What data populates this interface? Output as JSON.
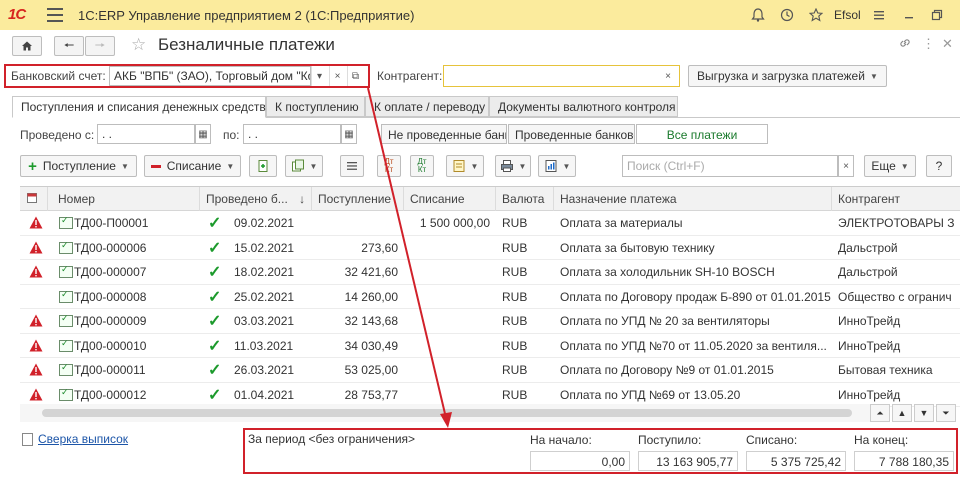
{
  "window": {
    "logo": "1С",
    "title": "1С:ERP Управление предприятием 2  (1С:Предприятие)",
    "user": "Efsol"
  },
  "page": {
    "title": "Безналичные платежи"
  },
  "filters": {
    "bank_label": "Банковский счет:",
    "bank_value": "АКБ \"ВПБ\" (ЗАО), Торговый дом \"Комплексный\"",
    "counterparty_label": "Контрагент:",
    "counterparty_value": "",
    "export_button": "Выгрузка и загрузка платежей",
    "date_from_label": "Проведено с:",
    "date_from_value": " .  .",
    "date_to_label": "по:",
    "date_to_value": " .  .",
    "status_not_posted": "Не проведенные банковские выписки",
    "status_posted": "Проведенные банковские выписки",
    "status_all": "Все платежи"
  },
  "tabs": [
    "Поступления и списания денежных средств",
    "К поступлению",
    "К оплате / переводу",
    "Документы валютного контроля"
  ],
  "toolbar": {
    "receipt": "Поступление",
    "writeoff": "Списание",
    "search_placeholder": "Поиск (Ctrl+F)",
    "more": "Еще",
    "help": "?",
    "dtkt_dt": "Дт",
    "dtkt_kt": "Кт"
  },
  "table": {
    "columns": [
      "Номер",
      "Проведено б...",
      "Поступление",
      "Списание",
      "Валюта",
      "Назначение платежа",
      "Контрагент"
    ],
    "rows": [
      {
        "warn": true,
        "number": "ТД00-П00001",
        "date": "09.02.2021",
        "receipt": "",
        "writeoff": "1 500 000,00",
        "currency": "RUB",
        "purpose": "Оплата за материалы",
        "counterparty": "ЭЛЕКТРОТОВАРЫ З"
      },
      {
        "warn": true,
        "number": "ТД00-000006",
        "date": "15.02.2021",
        "receipt": "273,60",
        "writeoff": "",
        "currency": "RUB",
        "purpose": "Оплата за бытовую технику",
        "counterparty": "Дальстрой"
      },
      {
        "warn": true,
        "number": "ТД00-000007",
        "date": "18.02.2021",
        "receipt": "32 421,60",
        "writeoff": "",
        "currency": "RUB",
        "purpose": "Оплата за холодильник SH-10 BOSCH",
        "counterparty": "Дальстрой"
      },
      {
        "warn": false,
        "number": "ТД00-000008",
        "date": "25.02.2021",
        "receipt": "14 260,00",
        "writeoff": "",
        "currency": "RUB",
        "purpose": "Оплата по Договору продаж Б-890 от 01.01.2015",
        "counterparty": "Общество с огранич"
      },
      {
        "warn": true,
        "number": "ТД00-000009",
        "date": "03.03.2021",
        "receipt": "32 143,68",
        "writeoff": "",
        "currency": "RUB",
        "purpose": "Оплата по УПД № 20 за вентиляторы",
        "counterparty": "ИнноТрейд"
      },
      {
        "warn": true,
        "number": "ТД00-000010",
        "date": "11.03.2021",
        "receipt": "34 030,49",
        "writeoff": "",
        "currency": "RUB",
        "purpose": "Оплата по УПД №70 от 11.05.2020 за вентиля...",
        "counterparty": "ИнноТрейд"
      },
      {
        "warn": true,
        "number": "ТД00-000011",
        "date": "26.03.2021",
        "receipt": "53 025,00",
        "writeoff": "",
        "currency": "RUB",
        "purpose": "Оплата по Договору №9 от 01.01.2015",
        "counterparty": "Бытовая техника"
      },
      {
        "warn": true,
        "number": "ТД00-000012",
        "date": "01.04.2021",
        "receipt": "28 753,77",
        "writeoff": "",
        "currency": "RUB",
        "purpose": "Оплата по УПД №69 от 13.05.20",
        "counterparty": "ИнноТрейд"
      }
    ]
  },
  "footer": {
    "reconcile_link": "Сверка выписок",
    "period": "За период <без ограничения>",
    "start_label": "На начало:",
    "start_value": "0,00",
    "received_label": "Поступило:",
    "received_value": "13 163 905,77",
    "written_label": "Списано:",
    "written_value": "5 375 725,42",
    "end_label": "На конец:",
    "end_value": "7 788 180,35"
  },
  "colors": {
    "titlebar": "#fbeb9d",
    "highlight": "#d1212a",
    "accent_green": "#1c9a2c"
  }
}
